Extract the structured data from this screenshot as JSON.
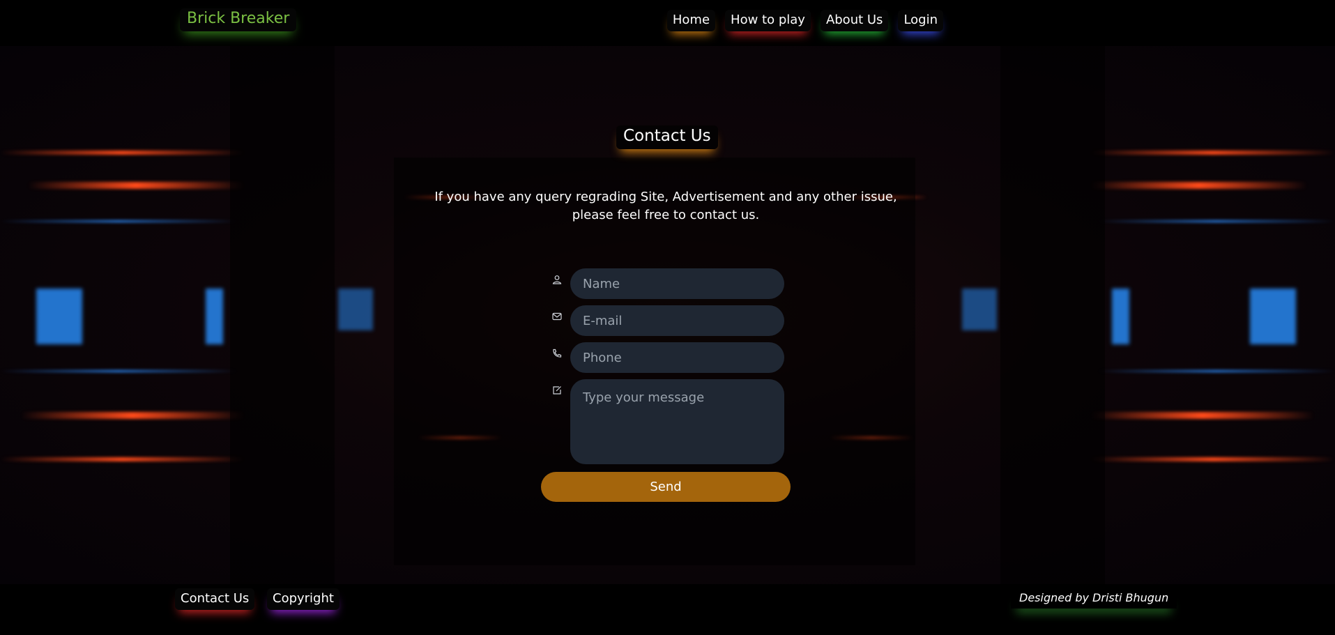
{
  "header": {
    "brand": "Brick Breaker",
    "nav": [
      {
        "label": "Home"
      },
      {
        "label": "How to play"
      },
      {
        "label": "About Us"
      },
      {
        "label": "Login"
      }
    ]
  },
  "contact": {
    "title": "Contact Us",
    "intro_line1": "If you have any query regrading Site, Advertisement and any other issue,",
    "intro_line2": "please feel free to contact us.",
    "fields": {
      "name_placeholder": "Name",
      "email_placeholder": "E-mail",
      "phone_placeholder": "Phone",
      "message_placeholder": "Type your message"
    },
    "send_label": "Send",
    "icons": [
      "user-icon",
      "mail-icon",
      "phone-icon",
      "edit-icon"
    ]
  },
  "footer": {
    "links": [
      {
        "label": "Contact Us"
      },
      {
        "label": "Copyright"
      }
    ],
    "credit": "Designed by Dristi Bhugun"
  },
  "colors": {
    "brand": "#7bc043",
    "send_button": "#a4650c",
    "input_bg": "#1f2733",
    "glow_orange": "#e68c14",
    "glow_red": "#e62828",
    "glow_green": "#28c83c",
    "glow_blue": "#3c50f0",
    "glow_purple": "#a028e6"
  }
}
